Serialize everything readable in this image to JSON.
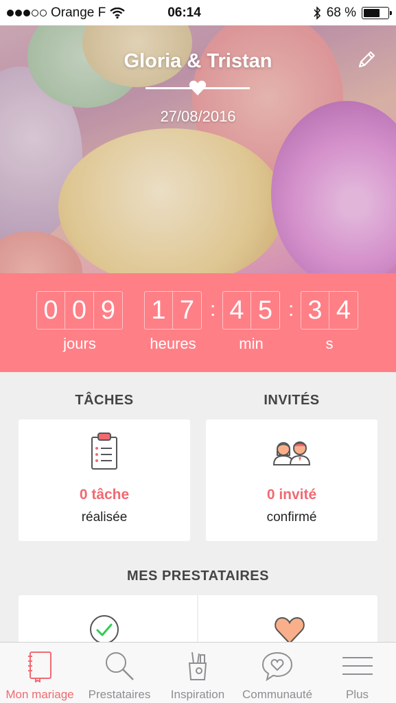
{
  "status_bar": {
    "carrier": "Orange F",
    "time": "06:14",
    "battery_percent": "68 %",
    "battery_level": 0.68
  },
  "hero": {
    "couple_name": "Gloria & Tristan",
    "wedding_date": "27/08/2016",
    "edit_icon": "pencil-icon"
  },
  "countdown": {
    "days_digits": [
      "0",
      "0",
      "9"
    ],
    "hours_digits": [
      "1",
      "7"
    ],
    "minutes_digits": [
      "4",
      "5"
    ],
    "seconds_digits": [
      "3",
      "4"
    ],
    "separator": ":",
    "labels": {
      "days": "jours",
      "hours": "heures",
      "minutes": "min",
      "seconds": "s"
    }
  },
  "tasks": {
    "title": "TÂCHES",
    "count": "0 tâche",
    "subtitle": "réalisée",
    "icon": "clipboard-icon"
  },
  "guests": {
    "title": "INVITÉS",
    "count": "0 invité",
    "subtitle": "confirmé",
    "icon": "couple-icon"
  },
  "vendors": {
    "title": "MES PRESTATAIRES",
    "icons": [
      "check-circle-icon",
      "heart-icon"
    ]
  },
  "tab_bar": {
    "items": [
      {
        "label": "Mon mariage",
        "icon": "notebook-icon",
        "active": true
      },
      {
        "label": "Prestataires",
        "icon": "search-icon",
        "active": false
      },
      {
        "label": "Inspiration",
        "icon": "pencil-cup-icon",
        "active": false
      },
      {
        "label": "Communauté",
        "icon": "chat-heart-icon",
        "active": false
      },
      {
        "label": "Plus",
        "icon": "menu-icon",
        "active": false
      }
    ]
  },
  "colors": {
    "accent": "#ff7f86",
    "accent_text": "#f06a72",
    "background": "#efefef"
  }
}
